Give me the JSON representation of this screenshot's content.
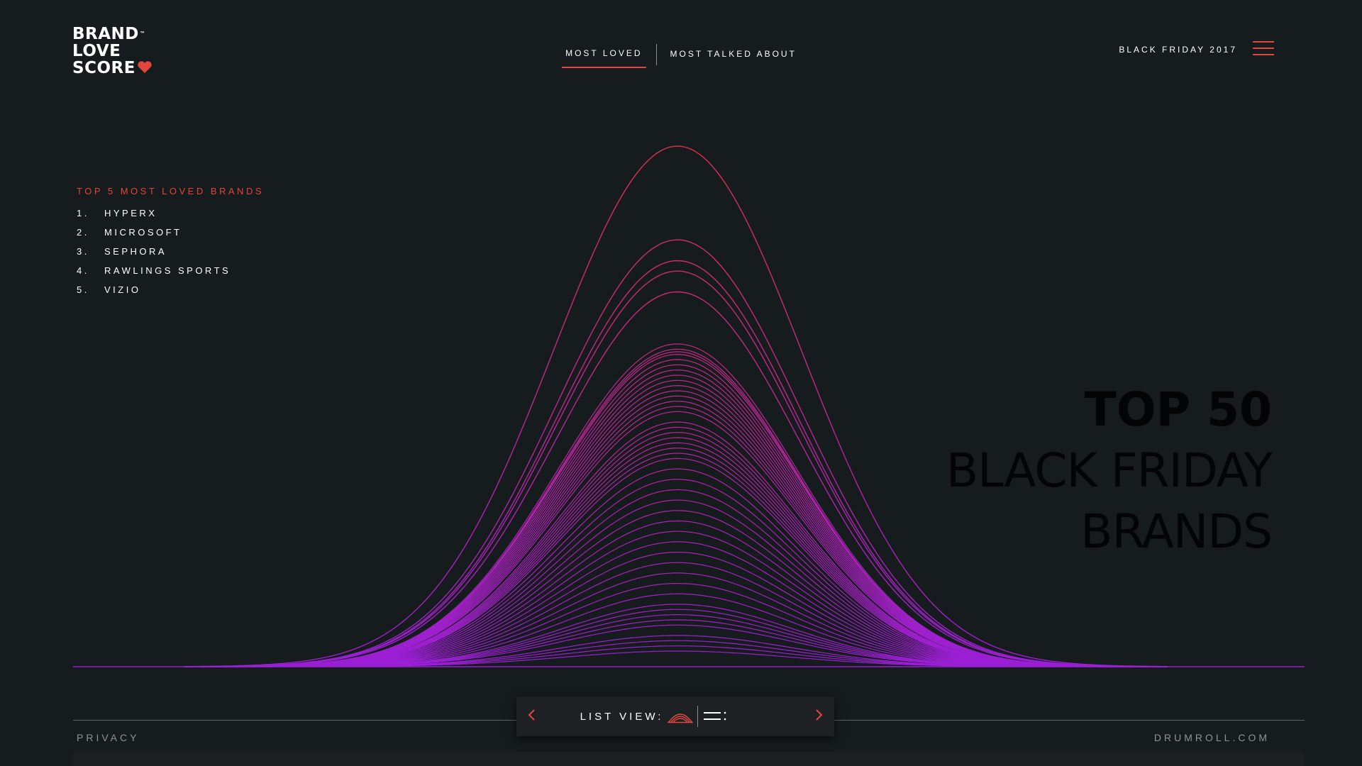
{
  "brand": {
    "logo_lines": [
      "BRAND",
      "LOVE",
      "SCORE"
    ],
    "trademark": "™"
  },
  "nav": {
    "tabs": [
      {
        "label": "MOST LOVED",
        "active": true
      },
      {
        "label": "MOST TALKED ABOUT",
        "active": false
      }
    ]
  },
  "header": {
    "event_label": "BLACK FRIDAY 2017"
  },
  "top5": {
    "heading": "TOP 5 MOST LOVED BRANDS",
    "items": [
      {
        "rank": "1.",
        "name": "HYPERX"
      },
      {
        "rank": "2.",
        "name": "MICROSOFT"
      },
      {
        "rank": "3.",
        "name": "SEPHORA"
      },
      {
        "rank": "4.",
        "name": "RAWLINGS SPORTS"
      },
      {
        "rank": "5.",
        "name": "VIZIO"
      }
    ]
  },
  "headline": {
    "line1": "TOP 50",
    "line2": "BLACK FRIDAY",
    "line3": "BRANDS"
  },
  "list_view": {
    "label": "LIST VIEW:",
    "prev_icon": "chevron-left-icon",
    "next_icon": "chevron-right-icon"
  },
  "footer": {
    "privacy": "PRIVACY",
    "site": "DRUMROLL.COM"
  },
  "colors": {
    "accent": "#e2463c",
    "curve_top": "#e0304a",
    "curve_bottom": "#9a1ed6",
    "background": "#161b1e"
  },
  "chart_data": {
    "type": "area",
    "series_count": 50,
    "relative_values": [
      1.0,
      0.82,
      0.78,
      0.76,
      0.72,
      0.62,
      0.61,
      0.605,
      0.6,
      0.59,
      0.58,
      0.57,
      0.56,
      0.55,
      0.54,
      0.53,
      0.52,
      0.51,
      0.5,
      0.49,
      0.47,
      0.46,
      0.45,
      0.44,
      0.43,
      0.42,
      0.41,
      0.4,
      0.38,
      0.36,
      0.34,
      0.32,
      0.3,
      0.28,
      0.26,
      0.24,
      0.22,
      0.2,
      0.18,
      0.16,
      0.14,
      0.12,
      0.11,
      0.1,
      0.09,
      0.08,
      0.06,
      0.05,
      0.04,
      0.03
    ]
  }
}
